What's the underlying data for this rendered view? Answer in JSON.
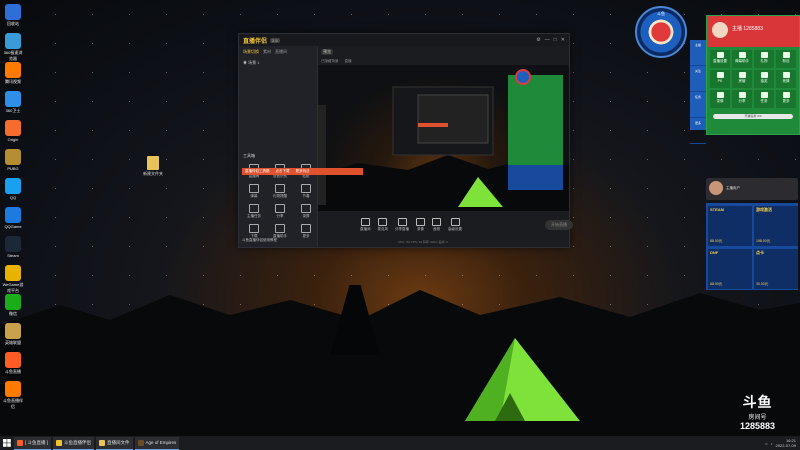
{
  "desktop_icons": [
    {
      "label": "回收站",
      "color": "#2d6fd6"
    },
    {
      "label": "360极速浏览器",
      "color": "#3a9bd9"
    },
    {
      "label": "腾讯视频",
      "color": "#ff7a00"
    },
    {
      "label": "360卫士",
      "color": "#2f8fe8"
    },
    {
      "label": "Origin",
      "color": "#f56c2d"
    },
    {
      "label": "PUBG",
      "color": "#b58d33"
    },
    {
      "label": "QQ",
      "color": "#1aa0f0"
    },
    {
      "label": "QQGame",
      "color": "#1d7be0"
    },
    {
      "label": "Steam",
      "color": "#1b2838"
    },
    {
      "label": "WeGame游戏平台",
      "color": "#e8b300"
    },
    {
      "label": "微信",
      "color": "#1aad19"
    },
    {
      "label": "英雄联盟",
      "color": "#c8a14a"
    },
    {
      "label": "斗鱼直播",
      "color": "#ff5d23"
    },
    {
      "label": "斗鱼直播伴侣",
      "color": "#ff7a00"
    }
  ],
  "desktop_folder": {
    "label": "新建文件夹"
  },
  "app": {
    "logo": "直播伴侣",
    "version": "2.5",
    "tabs": [
      "场景切换",
      "素材",
      "直播间"
    ],
    "scene": "场景 1",
    "tools_title": "工具箱",
    "tools": [
      "直播间",
      "语音识别",
      "贴纸",
      "弹幕",
      "礼物提醒",
      "节奏",
      "主播任务",
      "分享",
      "录屏",
      "下载",
      "直播助手",
      "更多"
    ],
    "banner": [
      "直播伴侣工具箱",
      "点击下载",
      "更多玩法"
    ],
    "left_footer": "斗鱼直播伴侣使用教程",
    "preview_label": "预览",
    "main_subtabs": [
      "已隐藏场景",
      "直播"
    ],
    "bottom_items": [
      "直播间",
      "麦克风",
      "分享直播",
      "录像",
      "音频",
      "高级设置"
    ],
    "live_button": "开始直播",
    "status": "CPU: 0%   FPS: 30   码率: 0kb/s   丢帧: 0"
  },
  "overlay": {
    "ring_label": "斗鱼",
    "side_strip": [
      "主播",
      "关注",
      "任务",
      "更多"
    ],
    "panel_user": "主播 1285883",
    "panel_grid": [
      "直播设置",
      "弹幕助手",
      "礼物",
      "粉丝",
      "PK",
      "房管",
      "抽奖",
      "竞猜",
      "录像",
      "分享",
      "任务",
      "更多"
    ],
    "progress_label": "开播任务 0/3",
    "user_row_name": "主播用户",
    "tiles": [
      {
        "title": "STEAM",
        "price": "88.00元"
      },
      {
        "title": "游戏激活",
        "price": "198.00元"
      },
      {
        "title": "DNF",
        "price": "68.00元"
      },
      {
        "title": "点卡",
        "price": "30.00元"
      }
    ]
  },
  "brand": {
    "logo": "斗鱼",
    "room_label": "房间号",
    "room_number": "1285883"
  },
  "taskbar": {
    "items": [
      {
        "label": "[ 斗鱼直播 ]",
        "color": "#ff5d23"
      },
      {
        "label": "斗鱼直播伴侣",
        "color": "#f0c330"
      },
      {
        "label": "直播间文件",
        "color": "#e8c35a"
      },
      {
        "label": "Age of Empires",
        "color": "#6b4b2a"
      }
    ],
    "time": "16:21",
    "date": "2022-07-09"
  },
  "colors": {
    "accent": "#f0c330",
    "douyu_orange": "#ff5d23",
    "panel_green": "#1f8a3a",
    "panel_blue": "#174a9c"
  }
}
